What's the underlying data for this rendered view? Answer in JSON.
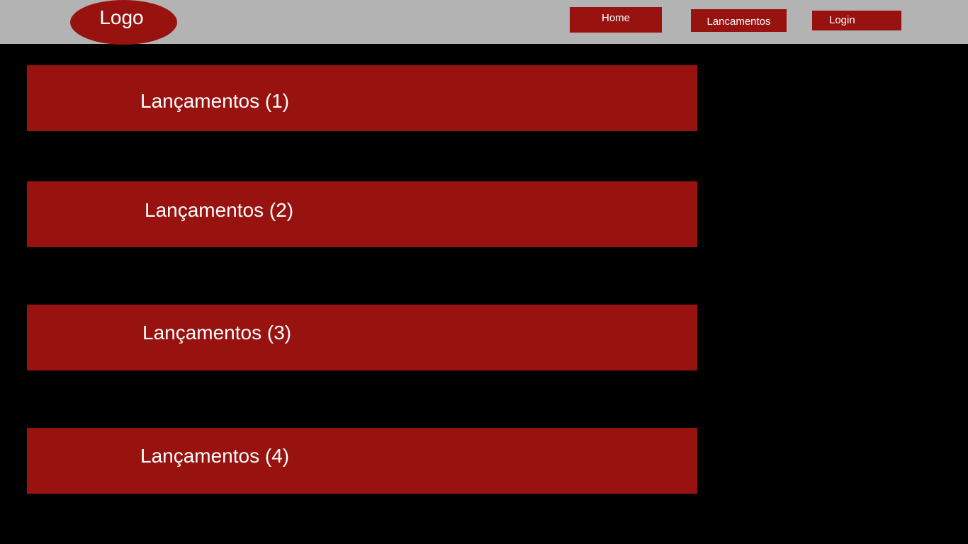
{
  "header": {
    "logo_label": "Logo",
    "nav": {
      "home_label": "Home",
      "lancamentos_label": "Lancamentos",
      "login_label": "Login"
    }
  },
  "main": {
    "cards": [
      {
        "label": "Lançamentos (1)"
      },
      {
        "label": "Lançamentos (2)"
      },
      {
        "label": "Lançamentos (3)"
      },
      {
        "label": "Lançamentos (4)"
      }
    ]
  },
  "colors": {
    "background": "#000000",
    "header_bg": "#b3b3b3",
    "accent_red": "#981210",
    "text": "#ffffff"
  }
}
